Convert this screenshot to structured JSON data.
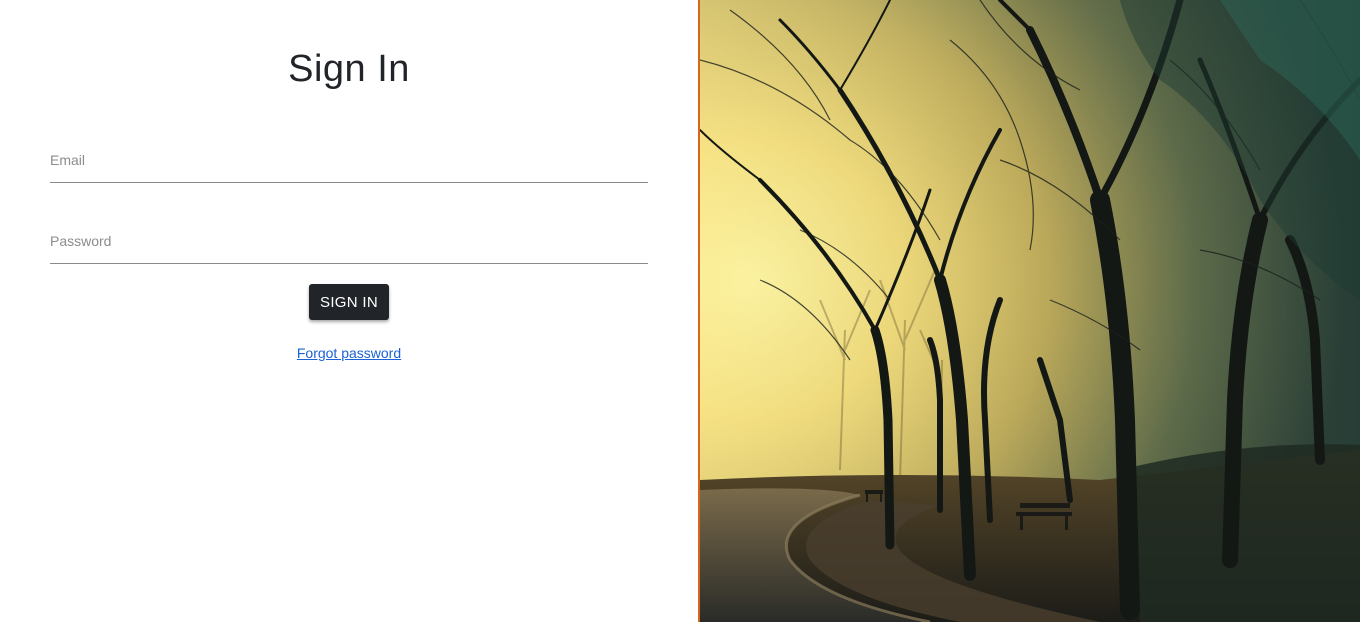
{
  "signin": {
    "title": "Sign In",
    "email_placeholder": "Email",
    "password_placeholder": "Password",
    "submit_label": "SIGN IN",
    "forgot_link": "Forgot password"
  },
  "colors": {
    "button_bg": "#212529",
    "link": "#1a62d6",
    "divider": "#d9651c"
  },
  "image": {
    "description_icon": "park-trees-photo"
  }
}
